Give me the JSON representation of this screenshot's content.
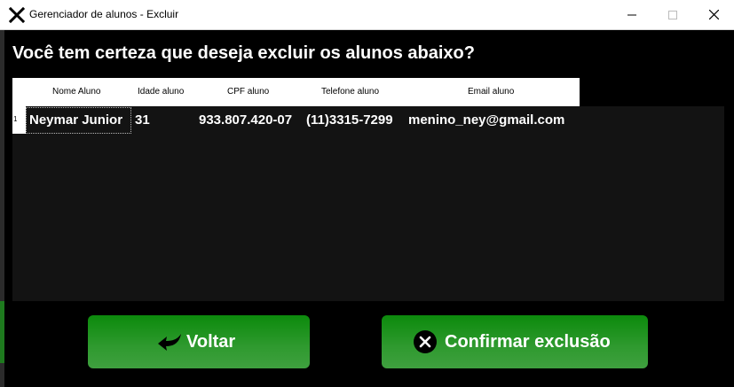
{
  "window": {
    "title": "Gerenciador de alunos - Excluir",
    "icons": {
      "app": "x-mark-icon",
      "minimize": "minimize-icon",
      "maximize": "maximize-icon",
      "close": "close-icon"
    }
  },
  "prompt": "Você tem certeza que deseja excluir os alunos abaixo?",
  "table": {
    "columns": [
      "Nome Aluno",
      "Idade aluno",
      "CPF aluno",
      "Telefone aluno",
      "Email aluno"
    ],
    "rows": [
      {
        "index": "1",
        "cells": [
          "Neymar Junior",
          "31",
          "933.807.420-07",
          "(11)3315-7299",
          "menino_ney@gmail.com"
        ]
      }
    ]
  },
  "buttons": {
    "back": {
      "label": "Voltar",
      "icon": "back-arrow-icon"
    },
    "confirm": {
      "label": "Confirmar exclusão",
      "icon": "cancel-circle-icon"
    }
  },
  "colors": {
    "button_green": "#1f8f1f",
    "background": "#000000",
    "grid_background": "#131313"
  }
}
